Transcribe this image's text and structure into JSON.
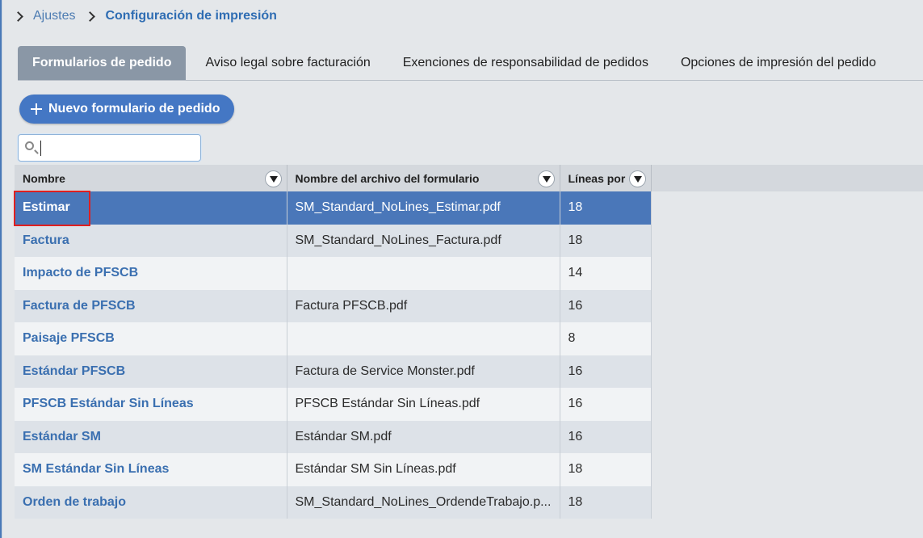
{
  "breadcrumb": {
    "parent": "Ajustes",
    "current": "Configuración de impresión"
  },
  "tabs": [
    {
      "label": "Formularios de pedido",
      "active": true
    },
    {
      "label": "Aviso legal sobre facturación",
      "active": false
    },
    {
      "label": "Exenciones de responsabilidad de pedidos",
      "active": false
    },
    {
      "label": "Opciones de impresión del pedido",
      "active": false
    }
  ],
  "new_button_label": "Nuevo formulario de pedido",
  "search": {
    "value": "",
    "placeholder": ""
  },
  "table": {
    "columns": [
      "Nombre",
      "Nombre del archivo del formulario",
      "Líneas por"
    ],
    "rows": [
      {
        "name": "Estimar",
        "file": "SM_Standard_NoLines_Estimar.pdf",
        "lines": "18",
        "selected": true
      },
      {
        "name": "Factura",
        "file": "SM_Standard_NoLines_Factura.pdf",
        "lines": "18"
      },
      {
        "name": "Impacto de PFSCB",
        "file": "",
        "lines": "14"
      },
      {
        "name": "Factura de PFSCB",
        "file": "Factura PFSCB.pdf",
        "lines": "16"
      },
      {
        "name": "Paisaje PFSCB",
        "file": "",
        "lines": "8"
      },
      {
        "name": "Estándar PFSCB",
        "file": "Factura de Service Monster.pdf",
        "lines": "16"
      },
      {
        "name": "PFSCB Estándar Sin Líneas",
        "file": "PFSCB Estándar Sin Líneas.pdf",
        "lines": "16"
      },
      {
        "name": "Estándar SM",
        "file": "Estándar SM.pdf",
        "lines": "16"
      },
      {
        "name": "SM Estándar Sin Líneas",
        "file": "Estándar SM Sin Líneas.pdf",
        "lines": "18"
      },
      {
        "name": "Orden de trabajo",
        "file": "SM_Standard_NoLines_OrdendeTrabajo.p...",
        "lines": "18"
      }
    ]
  },
  "colors": {
    "accent": "#4477c4",
    "selected_row": "#4a77b9",
    "highlight": "#e02020",
    "link": "#3a6fb0"
  }
}
